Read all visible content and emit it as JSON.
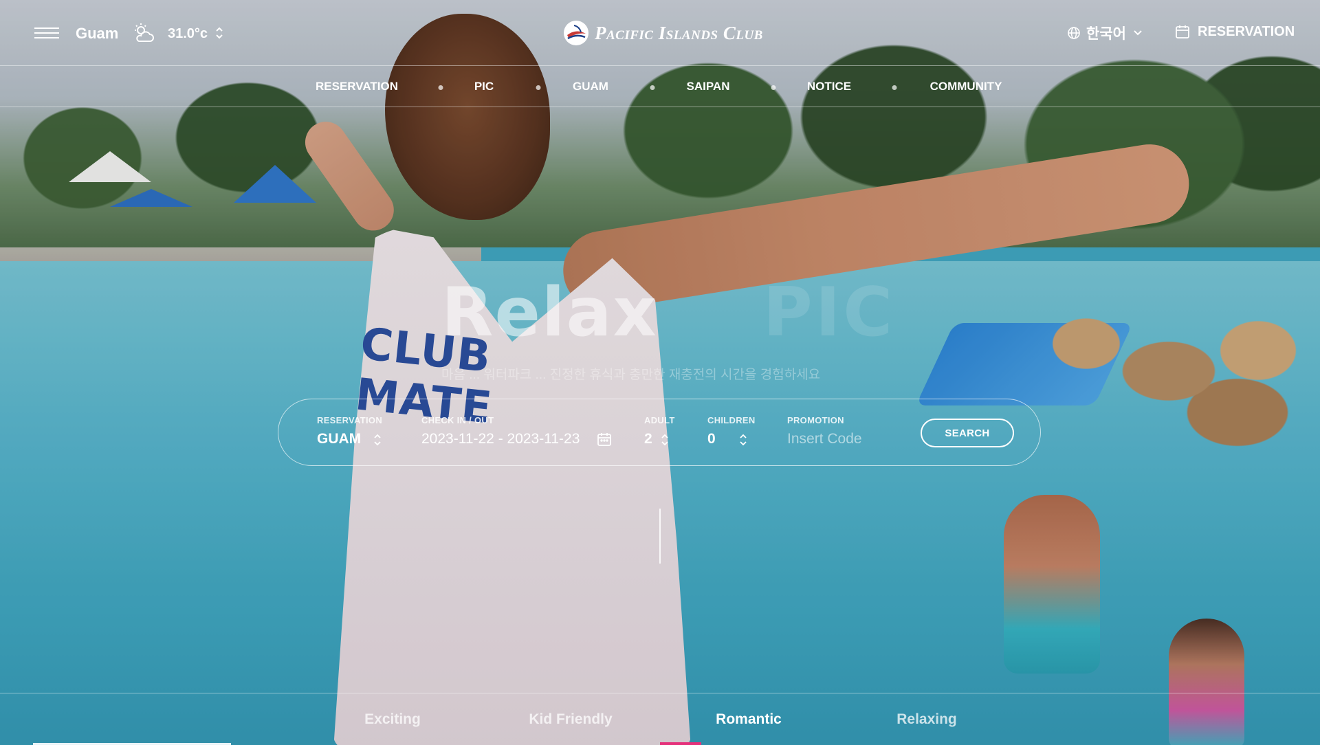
{
  "header": {
    "location": "Guam",
    "weather_icon": "partly-cloudy-icon",
    "temperature": "31.0°c",
    "logo_text": "Pacific Islands Club",
    "language": "한국어",
    "reservation_label": "RESERVATION"
  },
  "nav": {
    "items": [
      {
        "label": "RESERVATION"
      },
      {
        "label": "PIC"
      },
      {
        "label": "GUAM"
      },
      {
        "label": "SAIPAN"
      },
      {
        "label": "NOTICE"
      },
      {
        "label": "COMMUNITY"
      }
    ]
  },
  "hero": {
    "title": "Relax",
    "brand": "PIC",
    "subtitle": "마음 ... 워터파크 ... 진정한 휴식과 충만한 재충전의 시간을 경험하세요"
  },
  "booking": {
    "reservation_label": "RESERVATION",
    "reservation_value": "GUAM",
    "checkinout_label": "CHECK IN / OUT",
    "checkinout_value": "2023-11-22 - 2023-11-23",
    "adult_label": "ADULT",
    "adult_value": "2",
    "children_label": "CHILDREN",
    "children_value": "0",
    "promotion_label": "PROMOTION",
    "promotion_placeholder": "Insert Code",
    "search_label": "SEARCH"
  },
  "tabs": {
    "items": [
      {
        "label": "Exciting"
      },
      {
        "label": "Kid Friendly"
      },
      {
        "label": "Romantic"
      },
      {
        "label": "Relaxing"
      }
    ],
    "active_index": 2,
    "accent_color": "#e5307a"
  }
}
